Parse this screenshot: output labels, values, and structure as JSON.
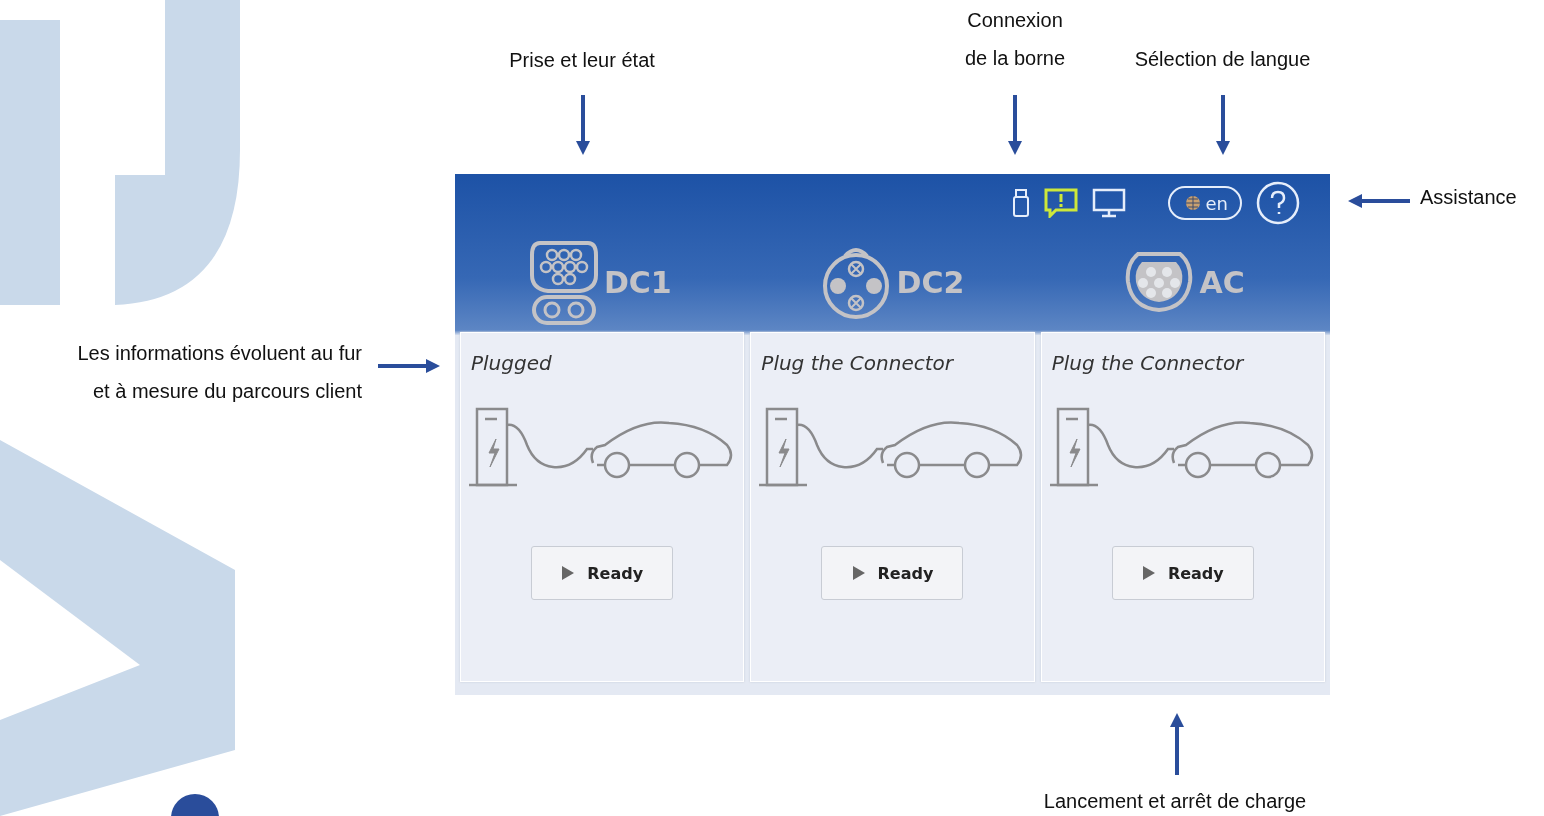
{
  "annotations": [
    {
      "lines": [
        "Prise et leur état"
      ],
      "kind": "down"
    },
    {
      "lines": [
        "Connexion",
        "de la borne"
      ],
      "kind": "down"
    },
    {
      "lines": [
        "Sélection de langue"
      ],
      "kind": "down"
    },
    {
      "lines": [
        "Assistance"
      ],
      "kind": "left"
    },
    {
      "lines": [
        "Les informations évoluent au fur",
        "et à mesure du parcours client"
      ],
      "kind": "right"
    },
    {
      "lines": [
        "Lancement et arrêt de charge"
      ],
      "kind": "up"
    }
  ],
  "screen": {
    "language": "en",
    "connectors": [
      {
        "name": "DC1",
        "kind": "ccs",
        "status": "Plugged",
        "button": "Ready"
      },
      {
        "name": "DC2",
        "kind": "chademo",
        "status": "Plug the Connector",
        "button": "Ready"
      },
      {
        "name": "AC",
        "kind": "type2",
        "status": "Plug the Connector",
        "button": "Ready"
      }
    ]
  }
}
